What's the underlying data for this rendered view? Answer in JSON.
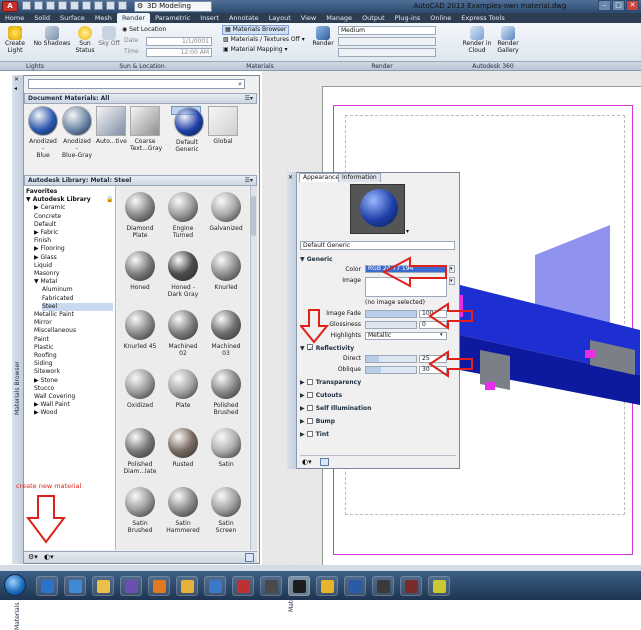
{
  "title_bar": {
    "app_button": "A",
    "workspace": "3D Modeling",
    "title": "AutoCAD 2013    Examples-own material.dwg"
  },
  "ribbon_tabs": [
    "Home",
    "Solid",
    "Surface",
    "Mesh",
    "Render",
    "Parametric",
    "Insert",
    "Annotate",
    "Layout",
    "View",
    "Manage",
    "Output",
    "Plug-ins",
    "Online",
    "Express Tools"
  ],
  "ribbon": {
    "create_light": "Create\nLight",
    "no_shadows": "No Shadows",
    "sun_status": "Sun\nStatus",
    "sky_off": "Sky Off",
    "set_location": "Set Location",
    "date_label": "Date",
    "date_value": "1/1/0001",
    "time_label": "Time",
    "time_value": "12:00 AM",
    "materials_browser": "Materials Browser",
    "materials_textures": "Materials / Textures Off",
    "material_mapping": "Material Mapping",
    "render": "Render",
    "render_preset": "Medium",
    "render_in_cloud": "Render in\nCloud",
    "render_gallery": "Render\nGallery"
  },
  "panel_labels": {
    "lights": "Lights",
    "sun_location": "Sun & Location",
    "materials": "Materials",
    "render": "Render",
    "autodesk360": "Autodesk 360"
  },
  "materials_browser": {
    "strip_label": "Materials Browser",
    "doc_header": "Document Materials: All",
    "doc_materials": [
      {
        "name": "Anodized -\nBlue",
        "color": "#2a58b0"
      },
      {
        "name": "Anodized -\nBlue-Gray",
        "color": "#6d87a8"
      },
      {
        "name": "Auto...tive",
        "color": "#7f8ea6"
      },
      {
        "name": "Coarse\nText...Gray",
        "color": "#8e8e8e"
      },
      {
        "name": "Default\nGeneric",
        "color": "#1d3fa8"
      },
      {
        "name": "Global",
        "color": "#d0d0d0"
      }
    ],
    "library_header": "Autodesk Library: Metal: Steel",
    "tree": [
      {
        "label": "Favorites",
        "indent": 0,
        "bold": true
      },
      {
        "label": "Autodesk Library",
        "indent": 0,
        "bold": true
      },
      {
        "label": "Ceramic",
        "indent": 1
      },
      {
        "label": "Concrete",
        "indent": 1
      },
      {
        "label": "Default",
        "indent": 1
      },
      {
        "label": "Fabric",
        "indent": 1
      },
      {
        "label": "Finish",
        "indent": 1
      },
      {
        "label": "Flooring",
        "indent": 1
      },
      {
        "label": "Glass",
        "indent": 1
      },
      {
        "label": "Liquid",
        "indent": 1
      },
      {
        "label": "Masonry",
        "indent": 1
      },
      {
        "label": "Metal",
        "indent": 1
      },
      {
        "label": "Aluminum",
        "indent": 2
      },
      {
        "label": "Fabricated",
        "indent": 2
      },
      {
        "label": "Steel",
        "indent": 2,
        "selected": true
      },
      {
        "label": "Metallic Paint",
        "indent": 1
      },
      {
        "label": "Mirror",
        "indent": 1
      },
      {
        "label": "Miscellaneous",
        "indent": 1
      },
      {
        "label": "Paint",
        "indent": 1
      },
      {
        "label": "Plastic",
        "indent": 1
      },
      {
        "label": "Roofing",
        "indent": 1
      },
      {
        "label": "Siding",
        "indent": 1
      },
      {
        "label": "Sitework",
        "indent": 1
      },
      {
        "label": "Stone",
        "indent": 1
      },
      {
        "label": "Stucco",
        "indent": 1
      },
      {
        "label": "Wall Covering",
        "indent": 1
      },
      {
        "label": "Wall Paint",
        "indent": 1
      },
      {
        "label": "Wood",
        "indent": 1
      }
    ],
    "grid_materials": [
      "Diamond\nPlate",
      "Engine\nTurned",
      "Galvanized",
      "Honed",
      "Honed -\nDark Gray",
      "Knurled",
      "Knurled 45",
      "Machined\n02",
      "Machined\n03",
      "Oxidized",
      "Plate",
      "Polished\nBrushed",
      "Polished\nDiam...late",
      "Rusted",
      "Satin",
      "Satin\nBrushed",
      "Satin\nHammered",
      "Satin\nScreen"
    ],
    "annotation": "create new material"
  },
  "materials_editor": {
    "strip_label": "Materials Editor",
    "tabs": [
      "Appearance",
      "Information"
    ],
    "name": "Default Generic",
    "generic_header": "Generic",
    "color_label": "Color",
    "color_value": "RGB 24 77 194",
    "image_label": "Image",
    "no_image": "(no image selected)",
    "image_fade_label": "Image Fade",
    "image_fade_value": "100",
    "glossiness_label": "Glossiness",
    "glossiness_value": "0",
    "highlights_label": "Highlights",
    "highlights_value": "Metallic",
    "reflectivity_header": "Reflectivity",
    "direct_label": "Direct",
    "direct_value": "25",
    "oblique_label": "Oblique",
    "oblique_value": "30",
    "collapsed_groups": [
      "Transparency",
      "Cutouts",
      "Self Illumination",
      "Bump",
      "Tint"
    ]
  },
  "colors": {
    "accent_red": "#e0211b",
    "model_blue": "#1d2fd0",
    "highlight_blue": "#3c6bd0"
  }
}
